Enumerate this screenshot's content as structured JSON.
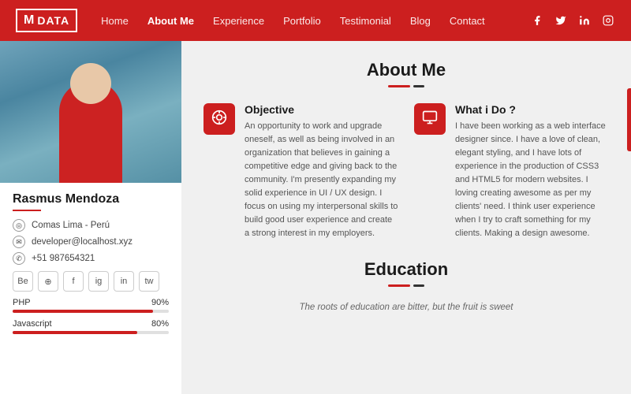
{
  "navbar": {
    "logo_icon": "M",
    "logo_text": "DATA",
    "links": [
      {
        "label": "Home",
        "active": false
      },
      {
        "label": "About Me",
        "active": true
      },
      {
        "label": "Experience",
        "active": false
      },
      {
        "label": "Portfolio",
        "active": false
      },
      {
        "label": "Testimonial",
        "active": false
      },
      {
        "label": "Blog",
        "active": false
      },
      {
        "label": "Contact",
        "active": false
      }
    ],
    "socials": [
      "f",
      "t",
      "in",
      "ig"
    ]
  },
  "sidebar": {
    "name": "Rasmus Mendoza",
    "location": "Comas Lima - Perú",
    "email": "developer@localhost.xyz",
    "phone": "+51 987654321",
    "social_icons": [
      "Be",
      "⊕",
      "f",
      "ig",
      "in",
      "tw"
    ],
    "skills": [
      {
        "label": "PHP",
        "percent": "90%",
        "value": 90
      },
      {
        "label": "Javascript",
        "percent": "80%",
        "value": 80
      }
    ]
  },
  "content": {
    "about_title": "About Me",
    "cards": [
      {
        "icon": "⊕",
        "title": "Objective",
        "text": "An opportunity to work and upgrade oneself, as well as being involved in an organization that believes in gaining a competitive edge and giving back to the community. I'm presently expanding my solid experience in UI / UX design. I focus on using my interpersonal skills to build good user experience and create a strong interest in my employers."
      },
      {
        "icon": "🖥",
        "title": "What i Do ?",
        "text": "I have been working as a web interface designer since. I have a love of clean, elegant styling, and I have lots of experience in the production of CSS3 and HTML5 for modern websites. I loving creating awesome as per my clients' need. I think user experience when I try to craft something for my clients. Making a design awesome."
      }
    ],
    "education_title": "Education",
    "education_subtitle": "The roots of education are bitter, but the fruit is sweet"
  }
}
